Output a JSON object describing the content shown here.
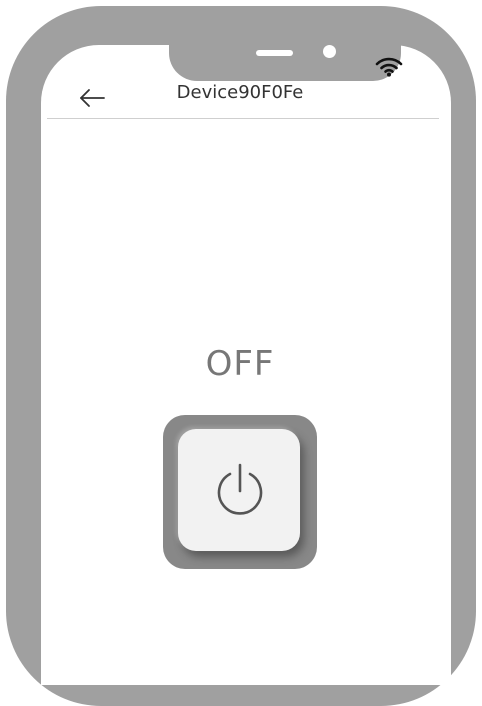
{
  "header": {
    "title": "Device90F0Fe"
  },
  "device": {
    "state_label": "OFF"
  },
  "icons": {
    "back": "arrow-left-icon",
    "wifi": "wifi-icon",
    "power": "power-icon"
  },
  "colors": {
    "frame": "#a0a0a0",
    "switch_outer": "#888888",
    "switch_face": "#f2f2f2",
    "state_text": "#777777",
    "title_text": "#333333"
  }
}
